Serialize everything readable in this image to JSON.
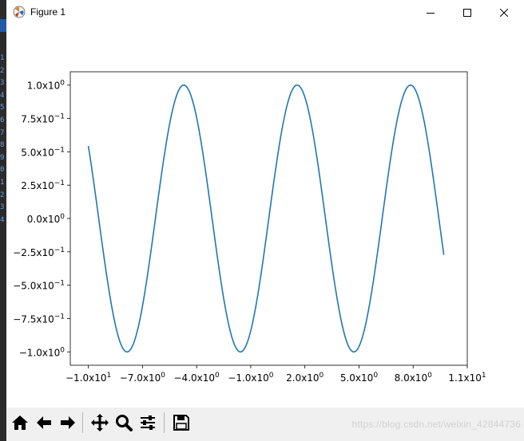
{
  "window": {
    "title": "Figure 1",
    "controls": [
      "minimize-icon",
      "maximize-icon",
      "close-icon"
    ]
  },
  "bg_line_numbers": [
    "1",
    "2",
    "3",
    "4",
    "5",
    "6",
    "7",
    "8",
    "9",
    "0",
    "1",
    "2",
    "3",
    "4"
  ],
  "chart_data": {
    "type": "line",
    "function": "sin",
    "x_start": -10,
    "x_end": 9.7,
    "xlim": [
      -11,
      11
    ],
    "ylim": [
      -1.1,
      1.1
    ],
    "xticks": [
      {
        "value": -10,
        "mant": "−1.0x10",
        "exp": "1"
      },
      {
        "value": -7,
        "mant": "−7.0x10",
        "exp": "0"
      },
      {
        "value": -4,
        "mant": "−4.0x10",
        "exp": "0"
      },
      {
        "value": -1,
        "mant": "−1.0x10",
        "exp": "0"
      },
      {
        "value": 2,
        "mant": "2.0x10",
        "exp": "0"
      },
      {
        "value": 5,
        "mant": "5.0x10",
        "exp": "0"
      },
      {
        "value": 8,
        "mant": "8.0x10",
        "exp": "0"
      },
      {
        "value": 11,
        "mant": "1.1x10",
        "exp": "1"
      }
    ],
    "yticks": [
      {
        "value": 1.0,
        "mant": "1.0x10",
        "exp": "0"
      },
      {
        "value": 0.75,
        "mant": "7.5x10",
        "exp": "−1"
      },
      {
        "value": 0.5,
        "mant": "5.0x10",
        "exp": "−1"
      },
      {
        "value": 0.25,
        "mant": "2.5x10",
        "exp": "−1"
      },
      {
        "value": 0.0,
        "mant": "0.0x10",
        "exp": "0"
      },
      {
        "value": -0.25,
        "mant": "−2.5x10",
        "exp": "−1"
      },
      {
        "value": -0.5,
        "mant": "−5.0x10",
        "exp": "−1"
      },
      {
        "value": -0.75,
        "mant": "−7.5x10",
        "exp": "−1"
      },
      {
        "value": -1.0,
        "mant": "−1.0x10",
        "exp": "0"
      }
    ],
    "line_color": "#1f77b4",
    "grid": false
  },
  "toolbar": {
    "buttons": [
      "home-icon",
      "back-icon",
      "forward-icon",
      "pan-icon",
      "zoom-icon",
      "configure-subplots-icon",
      "save-icon"
    ],
    "watermark": "https://blog.csdn.net/weixin_42844736"
  }
}
